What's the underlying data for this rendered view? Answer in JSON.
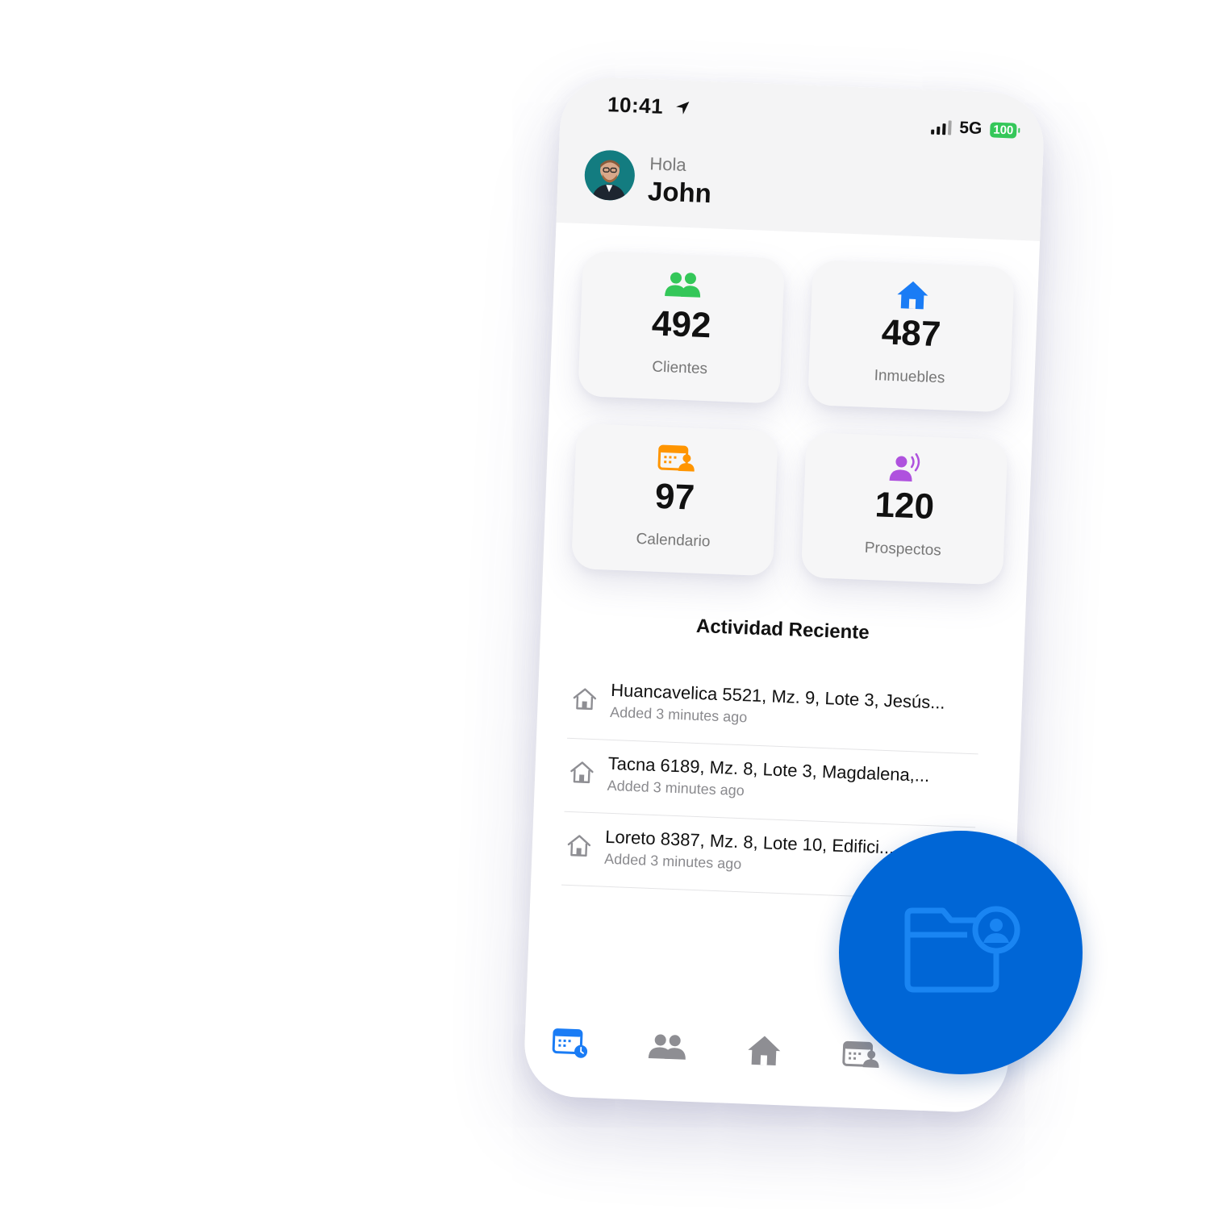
{
  "status_bar": {
    "time": "10:41",
    "network": "5G",
    "battery": "100"
  },
  "header": {
    "greeting": "Hola",
    "name": "John"
  },
  "stats": {
    "clientes": {
      "value": "492",
      "label": "Clientes",
      "icon": "people-icon",
      "color": "#34c759"
    },
    "inmuebles": {
      "value": "487",
      "label": "Inmuebles",
      "icon": "house-icon",
      "color": "#1a7cf5"
    },
    "calendario": {
      "value": "97",
      "label": "Calendario",
      "icon": "calendar-person-icon",
      "color": "#ff9500"
    },
    "prospectos": {
      "value": "120",
      "label": "Prospectos",
      "icon": "person-wave-icon",
      "color": "#af52de"
    }
  },
  "activity": {
    "title": "Actividad Reciente",
    "items": [
      {
        "title": "Huancavelica 5521, Mz. 9, Lote 3, Jesús...",
        "subtitle": "Added 3 minutes ago"
      },
      {
        "title": "Tacna 6189, Mz. 8, Lote 3, Magdalena,...",
        "subtitle": "Added 3 minutes ago"
      },
      {
        "title": "Loreto 8387, Mz. 8, Lote 10, Edifici...",
        "subtitle": "Added 3 minutes ago"
      }
    ]
  },
  "tabbar": {
    "tabs": [
      {
        "icon": "calendar-clock-icon",
        "active": true
      },
      {
        "icon": "people-icon",
        "active": false
      },
      {
        "icon": "house-icon",
        "active": false
      },
      {
        "icon": "calendar-person-icon",
        "active": false
      }
    ],
    "active_color": "#1a7cf5",
    "inactive_color": "#8e8e93"
  },
  "fab": {
    "icon": "folder-person-icon",
    "color": "#0066d6"
  }
}
